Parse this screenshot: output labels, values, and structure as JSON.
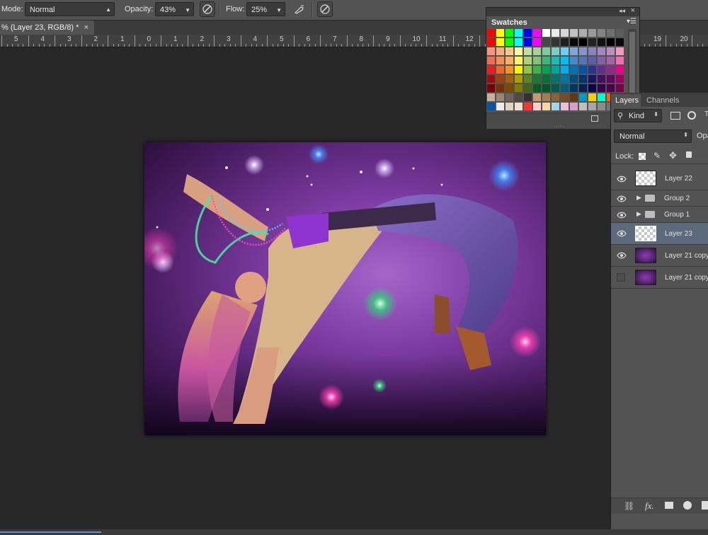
{
  "options_bar": {
    "mode_label": "Mode:",
    "mode_value": "Normal",
    "opacity_label": "Opacity:",
    "opacity_value": "43%",
    "flow_label": "Flow:",
    "flow_value": "25%"
  },
  "document_tab": {
    "title": "% (Layer 23, RGB/8) *",
    "close_glyph": "×"
  },
  "ruler": {
    "labels": [
      "5",
      "4",
      "3",
      "2",
      "1",
      "0",
      "1",
      "2",
      "3",
      "4",
      "5",
      "6",
      "7",
      "8",
      "9",
      "10",
      "11",
      "12",
      "19",
      "20"
    ]
  },
  "swatches": {
    "tab_label": "Swatches",
    "collapse_glyph": "◂◂",
    "close_glyph": "×",
    "rows": [
      [
        "#ff0000",
        "#ffff00",
        "#00ff00",
        "#00ffff",
        "#0000ff",
        "#ff00ff",
        "#ffffff",
        "#ebebeb",
        "#d6d6d6",
        "#c2c2c2",
        "#adadad",
        "#999999",
        "#858585",
        "#707070",
        "#5c5c5c"
      ],
      [
        "#ff0000",
        "#ffff00",
        "#00ff00",
        "#00ffff",
        "#0000ff",
        "#ff00ff",
        "#474747",
        "#333333",
        "#1f1f1f",
        "#0a0a0a",
        "#000000",
        "#222222",
        "#111111",
        "#000000",
        "#0a0a0a"
      ],
      [
        "#f7977a",
        "#f9ad81",
        "#fdc68a",
        "#fff79a",
        "#c4df9b",
        "#a2d39c",
        "#82ca9d",
        "#7bcdc8",
        "#6ecff6",
        "#7ea7d8",
        "#8493ca",
        "#8882be",
        "#a187be",
        "#bc8dbf",
        "#f49ac2"
      ],
      [
        "#f26c4f",
        "#f68e55",
        "#fbaf5c",
        "#fff467",
        "#acd372",
        "#7cc576",
        "#3bb878",
        "#1abbb4",
        "#00bff3",
        "#438ccb",
        "#5574b9",
        "#605ca8",
        "#855fa8",
        "#a763a8",
        "#f06ea9"
      ],
      [
        "#ed1c24",
        "#f26522",
        "#f7941d",
        "#fff200",
        "#8dc73f",
        "#39b54a",
        "#00a651",
        "#00a99d",
        "#00aeef",
        "#0072bc",
        "#0054a5",
        "#2e3192",
        "#662d91",
        "#92278f",
        "#ec008c"
      ],
      [
        "#9e0b0f",
        "#a0410d",
        "#a36209",
        "#aba000",
        "#598527",
        "#1a7b30",
        "#007236",
        "#00746b",
        "#0076a3",
        "#004b80",
        "#003471",
        "#1b1464",
        "#440e62",
        "#630460",
        "#9e005d"
      ],
      [
        "#790000",
        "#7b2e00",
        "#7d4900",
        "#827b00",
        "#406618",
        "#005e20",
        "#005826",
        "#005952",
        "#005b7f",
        "#003663",
        "#002157",
        "#0d004c",
        "#32004b",
        "#4b0049",
        "#7b0046"
      ],
      [
        "#c7b299",
        "#998675",
        "#736357",
        "#534741",
        "#37302d",
        "#c69c6d",
        "#a67c52",
        "#8c6239",
        "#754c24",
        "#603913",
        "#0099cc",
        "#ffcc00",
        "#00ffcc",
        "#ff6600",
        "#cccccc"
      ],
      [
        "#0054a6",
        "#ebebeb",
        "#e0d4c4",
        "#f0e0cc",
        "#ff3333",
        "#ffcccc",
        "#f9d5a0",
        "#9fd7e6",
        "#e8c1d6",
        "#d6a0c8",
        "#bfbfbf",
        "#a6a6a6",
        "#8c8c8c",
        "#737373",
        "#595959"
      ]
    ]
  },
  "layers": {
    "tabs": [
      "Layers",
      "Channels"
    ],
    "filter_label": "Kind",
    "blend_mode": "Normal",
    "opacity_label": "Opa",
    "lock_label": "Lock:",
    "items": [
      {
        "name": "Layer 22",
        "kind": "transparent",
        "visible": true
      },
      {
        "name": "Group 2",
        "kind": "group",
        "visible": true
      },
      {
        "name": "Group 1",
        "kind": "group",
        "visible": true
      },
      {
        "name": "Layer 23",
        "kind": "transparent",
        "visible": true,
        "selected": true
      },
      {
        "name": "Layer 21 copy",
        "kind": "image",
        "visible": true
      },
      {
        "name": "Layer 21 copy",
        "kind": "image",
        "visible": false
      }
    ],
    "footer_fx": "fx."
  },
  "colors": {
    "ui_bg": "#535353",
    "canvas_bg": "#282828",
    "selected_row": "#5d6a7d",
    "accent_blue": "#5b8fd6"
  }
}
